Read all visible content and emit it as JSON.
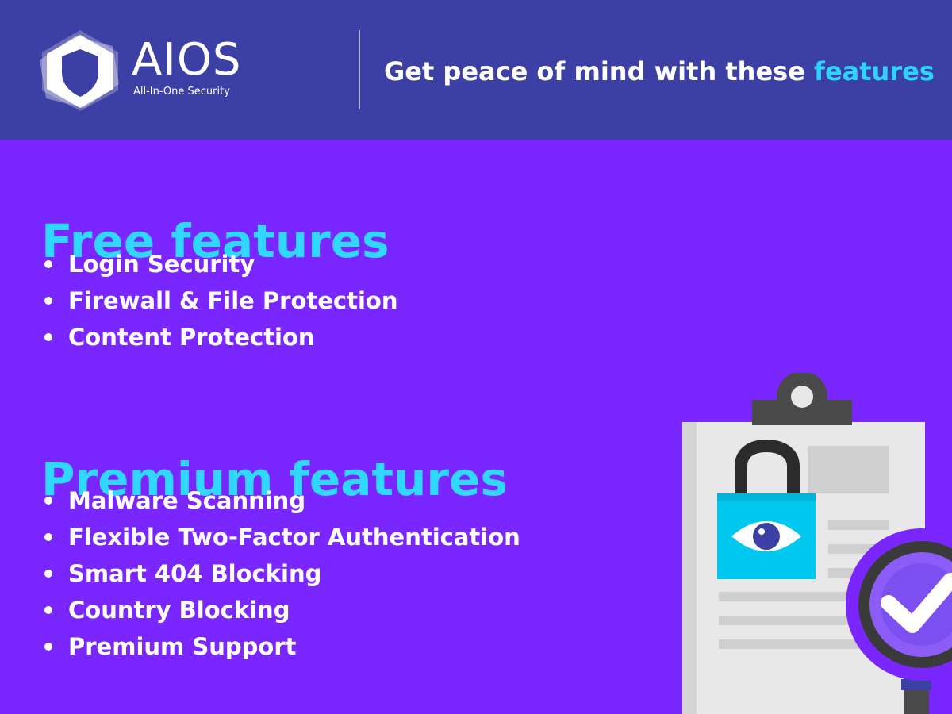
{
  "brand": {
    "name": "AIOS",
    "subtitle": "All-In-One Security"
  },
  "header": {
    "tagline_prefix": "Get peace of mind with these ",
    "tagline_accent": "features"
  },
  "free": {
    "title": "Free features",
    "items": [
      {
        "label": "Login Security"
      },
      {
        "label": "Firewall & File Protection"
      },
      {
        "label": "Content Protection"
      }
    ]
  },
  "premium": {
    "title": "Premium features",
    "items": [
      {
        "label": "Malware Scanning"
      },
      {
        "label": "Flexible Two-Factor Authentication"
      },
      {
        "label": "Smart 404 Blocking"
      },
      {
        "label": "Country Blocking"
      },
      {
        "label": "Premium Support"
      }
    ]
  },
  "colors": {
    "header_bg": "#3c3fa3",
    "page_bg": "#7a27ff",
    "accent": "#30d7ff",
    "text": "#ffffff"
  },
  "icons": {
    "logo": "shield-icon",
    "illustration": "clipboard-lock-check-icon"
  }
}
